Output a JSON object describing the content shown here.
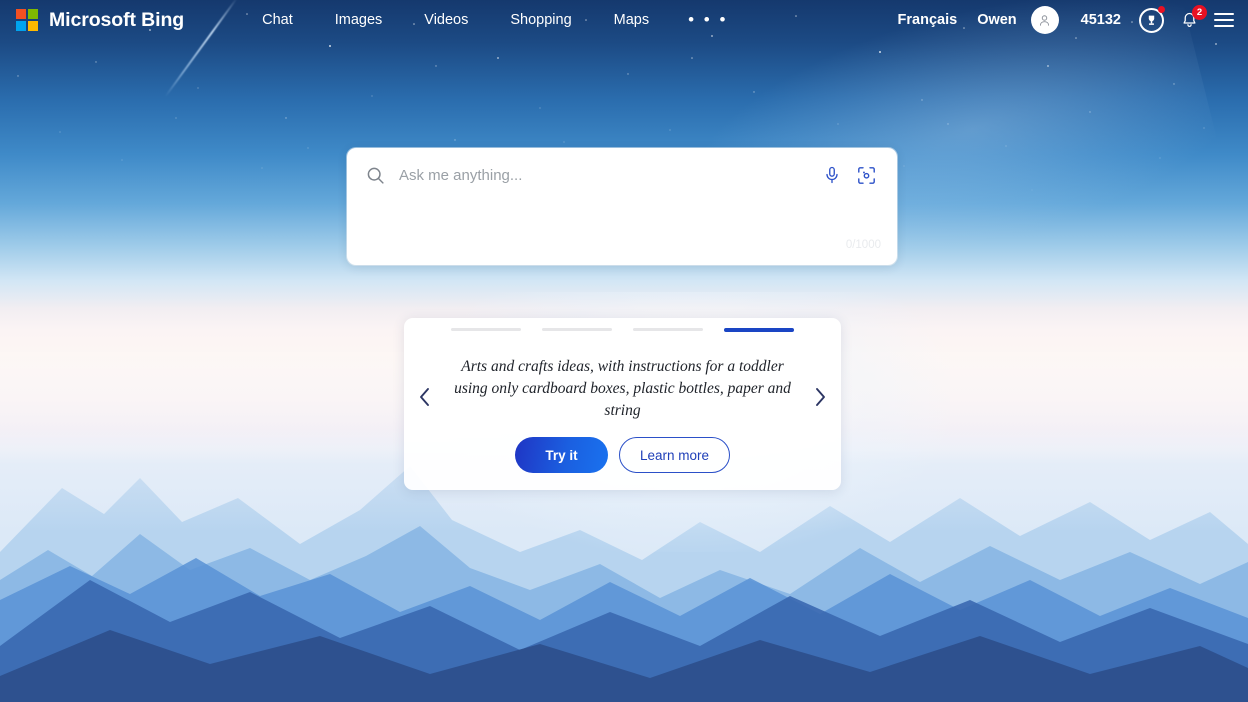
{
  "header": {
    "brand": {
      "name": "Microsoft Bing",
      "logo_icon": "microsoft-logo-icon"
    },
    "logo_colors": {
      "red": "#f25022",
      "green": "#7fba00",
      "blue": "#00a4ef",
      "yellow": "#ffb900"
    },
    "nav": [
      {
        "label": "Chat",
        "name": "chat"
      },
      {
        "label": "Images",
        "name": "images"
      },
      {
        "label": "Videos",
        "name": "videos"
      },
      {
        "label": "Shopping",
        "name": "shopping"
      },
      {
        "label": "Maps",
        "name": "maps"
      },
      {
        "label": "• • •",
        "name": "more"
      }
    ],
    "right": {
      "language": "Français",
      "username": "Owen",
      "avatar_icon": "person-avatar-icon",
      "points": "45132",
      "rewards_icon": "rewards-trophy-icon",
      "rewards_has_alert": true,
      "notifications_icon": "notification-bell-icon",
      "notifications_count": "2",
      "menu_icon": "hamburger-menu-icon"
    }
  },
  "search": {
    "placeholder": "Ask me anything...",
    "value": "",
    "search_icon": "search-icon",
    "mic_icon": "microphone-icon",
    "visual_search_icon": "visual-search-camera-icon",
    "counter": "0/1000"
  },
  "carousel": {
    "pips": [
      {
        "active": false
      },
      {
        "active": false
      },
      {
        "active": false
      },
      {
        "active": true
      }
    ],
    "active_color": "#1a45c4",
    "prompt": "Arts and crafts ideas, with instructions for a toddler using only cardboard boxes, plastic bottles, paper and string",
    "try_label": "Try it",
    "learn_label": "Learn more",
    "prev_icon": "chevron-left-icon",
    "next_icon": "chevron-right-icon"
  },
  "background": {
    "scene": "starry night sky over layered blue mountain ranges",
    "sky_top_color": "#15396e",
    "mist_color": "#fdf7f5",
    "mountain_color": "#4a7fc4"
  }
}
